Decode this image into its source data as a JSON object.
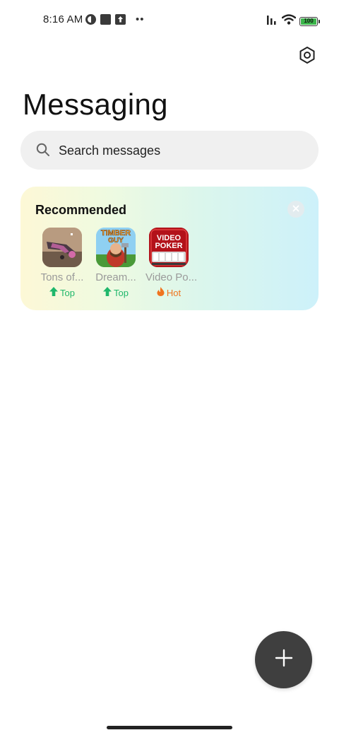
{
  "status_bar": {
    "time": "8:16 AM",
    "battery_level": "100",
    "icons": [
      "data-saver-icon",
      "square-notification-icon",
      "upload-icon",
      "more-dots-icon",
      "signal-icon",
      "wifi-icon",
      "battery-icon"
    ]
  },
  "header": {
    "title": "Messaging",
    "settings_icon": "settings-hexagon-icon"
  },
  "search": {
    "placeholder": "Search messages",
    "icon": "search-icon"
  },
  "recommended": {
    "title": "Recommended",
    "close_icon": "close-icon",
    "apps": [
      {
        "name": "Tons of...",
        "badge": "Top",
        "badge_icon": "arrow-up-icon",
        "badge_color": "#1fb76b"
      },
      {
        "name": "Dream...",
        "badge": "Top",
        "badge_icon": "arrow-up-icon",
        "badge_color": "#1fb76b"
      },
      {
        "name": "Video Po...",
        "badge": "Hot",
        "badge_icon": "flame-icon",
        "badge_color": "#f0741e"
      }
    ],
    "app_icon_text": {
      "timber_line1": "TIMBER",
      "timber_line2": "GUY",
      "poker_line1": "VIDEO",
      "poker_line2": "POKER"
    }
  },
  "fab": {
    "icon": "plus-icon"
  },
  "colors": {
    "accent_top": "#1fb76b",
    "accent_hot": "#f0741e",
    "fab_bg": "#3f3f3f",
    "search_bg": "#f0f0f0"
  }
}
